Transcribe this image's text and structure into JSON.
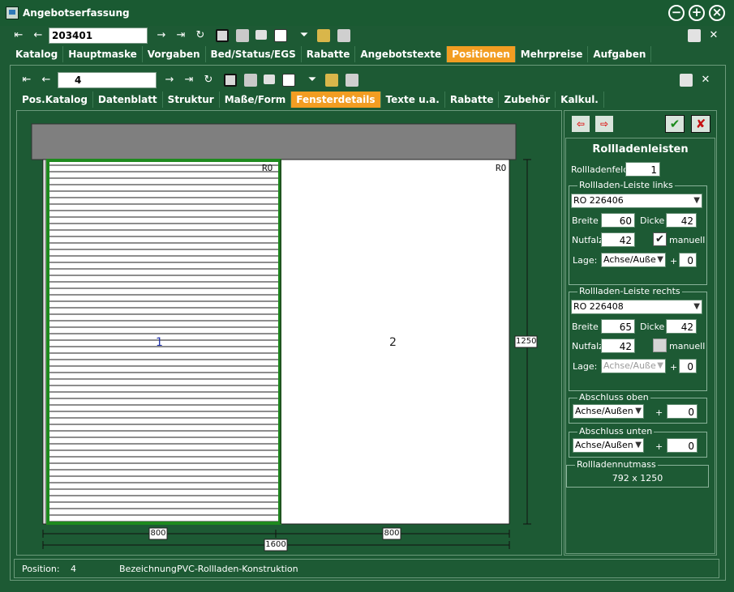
{
  "window": {
    "title": "Angebotserfassung",
    "buttons": [
      "minimize",
      "maximize",
      "close"
    ]
  },
  "toolbar_main": {
    "record_value": "203401"
  },
  "main_tabs": [
    "Katalog",
    "Hauptmaske",
    "Vorgaben",
    "Bed/Status/EGS",
    "Rabatte",
    "Angebotstexte",
    "Positionen",
    "Mehrpreise",
    "Aufgaben"
  ],
  "main_tabs_active": "Positionen",
  "toolbar_sub": {
    "record_value": "4"
  },
  "sub_tabs": [
    "Pos.Katalog",
    "Datenblatt",
    "Struktur",
    "Maße/Form",
    "Fensterdetails",
    "Texte u.a.",
    "Rabatte",
    "Zubehör",
    "Kalkul."
  ],
  "sub_tabs_active": "Fensterdetails",
  "drawing": {
    "field1_label": "1",
    "field2_label": "2",
    "ro_label_left": "RO",
    "ro_label_right": "RO",
    "dim_height": "1250",
    "dim_left_width": "800",
    "dim_right_width": "800",
    "dim_total_width": "1600"
  },
  "right_panel": {
    "heading": "Rollladenleisten",
    "rollladenfeld_label": "Rollladenfeld",
    "rollladenfeld_value": "1",
    "left_group": {
      "title": "Rollladen-Leiste links",
      "profile": "RO 226406",
      "breite_label": "Breite",
      "breite_value": "60",
      "dicke_label": "Dicke",
      "dicke_value": "42",
      "nutfalz_label": "Nutfalz",
      "nutfalz_value": "42",
      "manuell_label": "manuell",
      "manuell_checked": true,
      "lage_label": "Lage:",
      "lage_value": "Achse/Auße",
      "plus": "+",
      "offset_value": "0"
    },
    "right_group": {
      "title": "Rollladen-Leiste rechts",
      "profile": "RO 226408",
      "breite_label": "Breite",
      "breite_value": "65",
      "dicke_label": "Dicke",
      "dicke_value": "42",
      "nutfalz_label": "Nutfalz",
      "nutfalz_value": "42",
      "manuell_label": "manuell",
      "manuell_checked": false,
      "lage_label": "Lage:",
      "lage_value": "Achse/Auße",
      "plus": "+",
      "offset_value": "0"
    },
    "abschluss_oben": {
      "title": "Abschluss oben",
      "value": "Achse/Außen",
      "plus": "+",
      "offset_value": "0"
    },
    "abschluss_unten": {
      "title": "Abschluss unten",
      "value": "Achse/Außen",
      "plus": "+",
      "offset_value": "0"
    },
    "nutmass": {
      "title": "Rollladennutmass",
      "value": "792 x 1250"
    }
  },
  "status": {
    "position_label": "Position:",
    "position_value": "4",
    "bezeichnung_label": "Bezeichnung:",
    "bezeichnung_value": "PVC-Rollladen-Konstruktion"
  },
  "colors": {
    "background": "#1d5a34",
    "active_tab": "#f29d22",
    "accent_green": "#1e8a1e",
    "frame_gray": "#7f7f7f",
    "slat_line": "#1b1b1b"
  }
}
